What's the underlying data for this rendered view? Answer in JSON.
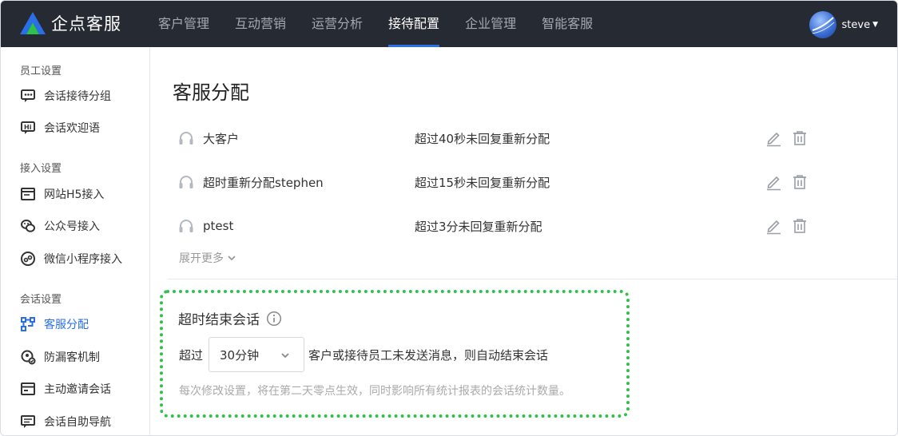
{
  "app": {
    "logo_text": "企点客服",
    "brand_color": "#2a6fe8",
    "accent_green": "#2ec24a"
  },
  "nav": {
    "items": [
      "客户管理",
      "互动营销",
      "运营分析",
      "接待配置",
      "企业管理",
      "智能客服"
    ],
    "active": "接待配置"
  },
  "user": {
    "name": "steve"
  },
  "sidebar": {
    "groups": [
      {
        "title": "员工设置",
        "items": [
          {
            "label": "会话接待分组",
            "icon": "chat-group-icon"
          },
          {
            "label": "会话欢迎语",
            "icon": "hi-greeting-icon"
          }
        ]
      },
      {
        "title": "接入设置",
        "items": [
          {
            "label": "网站H5接入",
            "icon": "web-window-icon"
          },
          {
            "label": "公众号接入",
            "icon": "wechat-icon"
          },
          {
            "label": "微信小程序接入",
            "icon": "mini-program-icon"
          }
        ]
      },
      {
        "title": "会话设置",
        "items": [
          {
            "label": "客服分配",
            "icon": "distribute-icon"
          },
          {
            "label": "防漏客机制",
            "icon": "anti-leak-icon"
          },
          {
            "label": "主动邀请会话",
            "icon": "invite-icon"
          },
          {
            "label": "会话自助导航",
            "icon": "self-nav-icon"
          }
        ]
      }
    ],
    "active": "客服分配"
  },
  "main": {
    "title": "客服分配",
    "groups": [
      {
        "name": "大客户",
        "rule": "超过40秒未回复重新分配"
      },
      {
        "name": "超时重新分配stephen",
        "rule": "超过15秒未回复重新分配"
      },
      {
        "name": "ptest",
        "rule": "超过3分未回复重新分配"
      }
    ],
    "more_label": "展开更多",
    "timeout": {
      "title": "超时结束会话",
      "prefix": "超过",
      "selected": "30分钟",
      "suffix": "客户或接待员工未发送消息，则自动结束会话",
      "hint": "每次修改设置，将在第二天零点生效，同时影响所有统计报表的会话统计数量。"
    }
  }
}
